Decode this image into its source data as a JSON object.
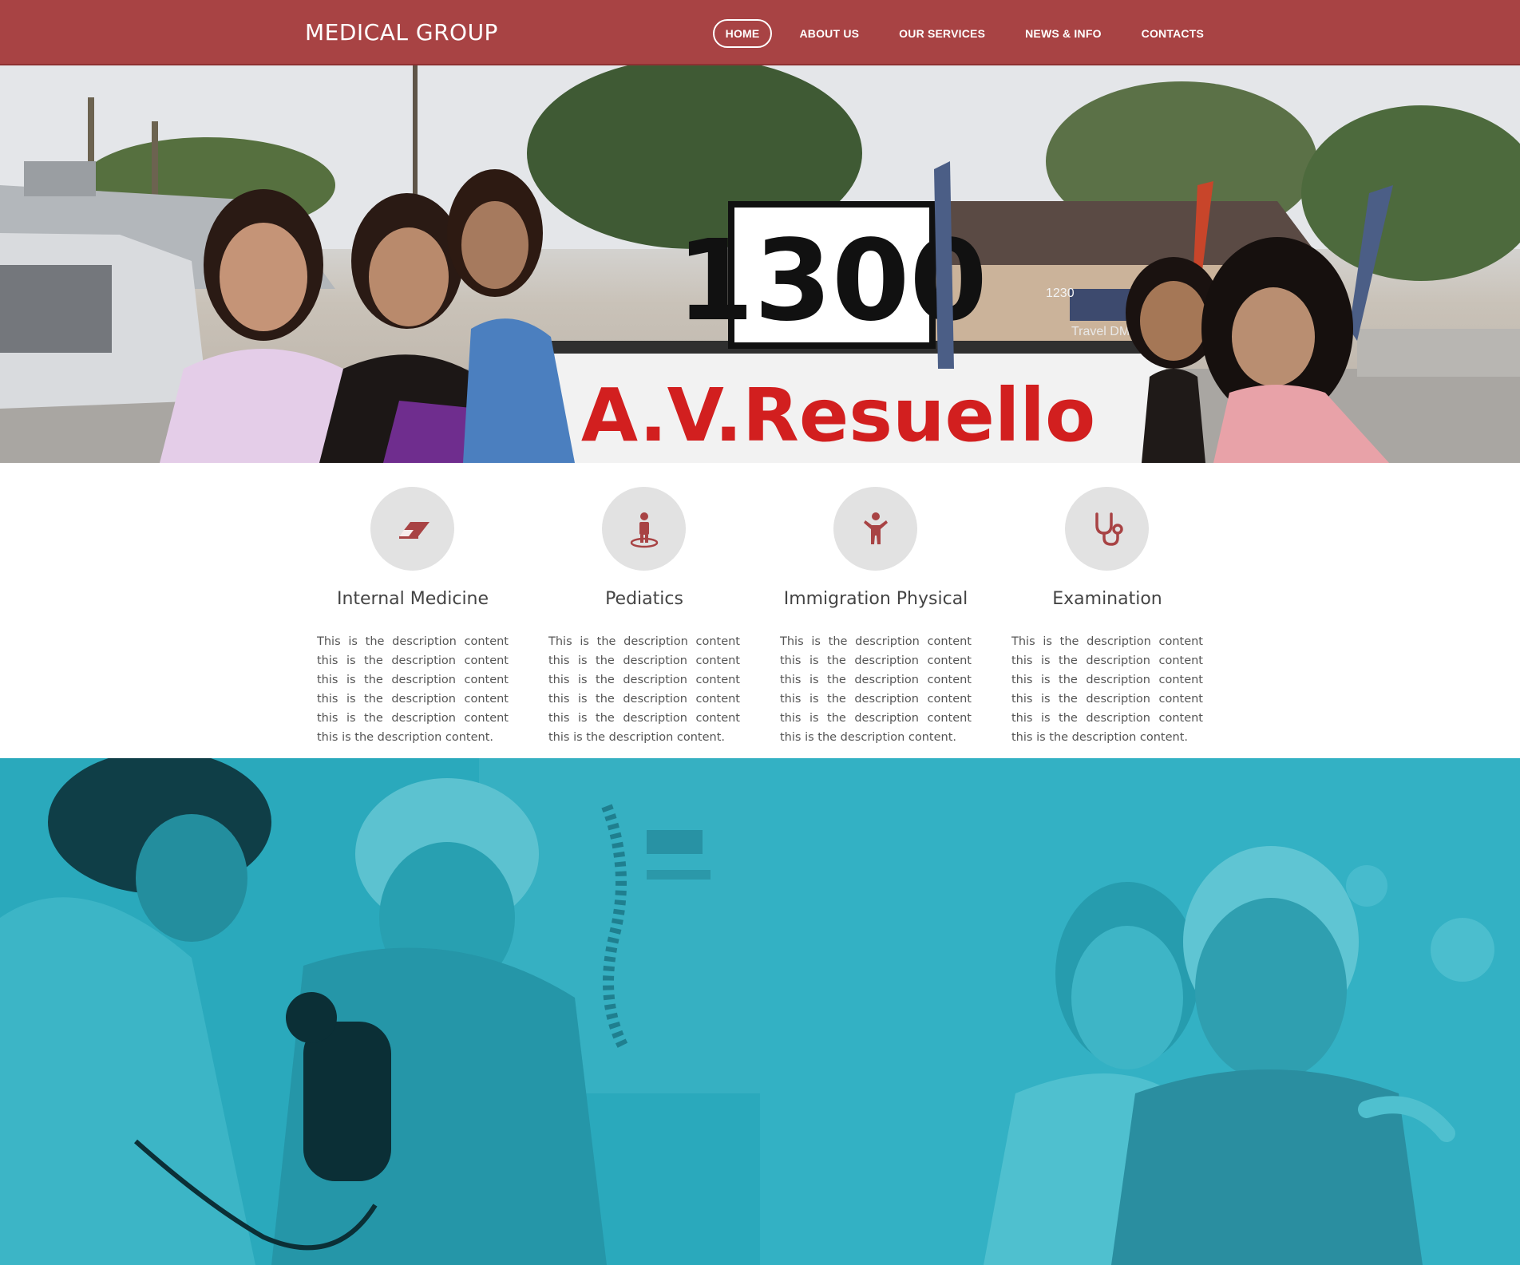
{
  "header": {
    "brand": "MEDICAL GROUP",
    "nav": [
      {
        "label": "HOME",
        "active": true
      },
      {
        "label": "ABOUT US",
        "active": false
      },
      {
        "label": "OUR SERVICES",
        "active": false
      },
      {
        "label": "NEWS & INFO",
        "active": false
      },
      {
        "label": "CONTACTS",
        "active": false
      }
    ],
    "bg_color": "#a84344"
  },
  "hero": {
    "sign_number": "1300",
    "sign_text": "A.V.Resuello",
    "address_number": "1230",
    "storefront_text": "Travel DMV"
  },
  "services": [
    {
      "icon": "eraser-icon",
      "title": "Internal Medicine",
      "description": "This is the description content this is the description content this is the description content this is the description content this is the description content this is the description content."
    },
    {
      "icon": "person-icon",
      "title": "Pediatics",
      "description": "This is the description content this is the description content this is the description content this is the description content this is the description content this is the description content."
    },
    {
      "icon": "child-icon",
      "title": "Immigration Physical",
      "description": "This is the description content this is the description content this is the description content this is the description content this is the description content this is the description content."
    },
    {
      "icon": "stethoscope-icon",
      "title": "Examination",
      "description": "This is the description content this is the description content this is the description content this is the description content this is the description content this is the description content."
    }
  ],
  "colors": {
    "accent": "#a84344",
    "icon_circle": "#e2e2e2",
    "teal_overlay": "#2aa9bc"
  }
}
